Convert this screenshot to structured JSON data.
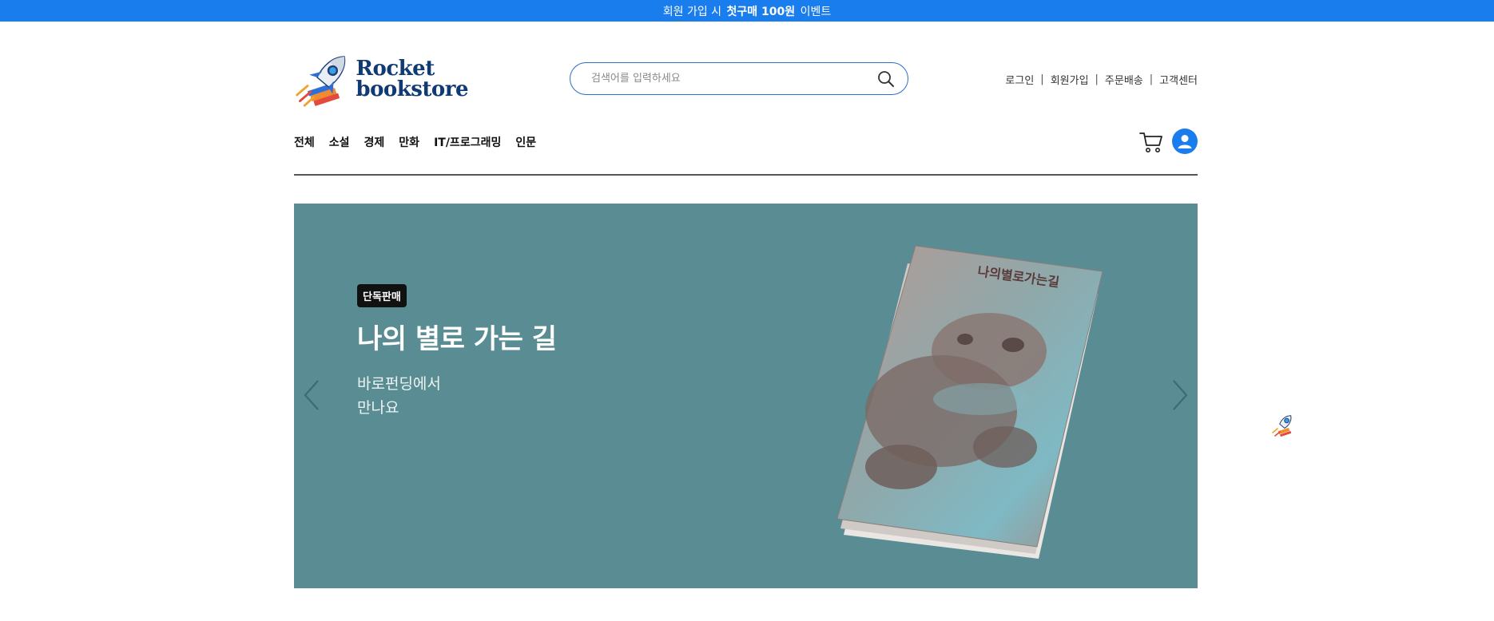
{
  "banner": {
    "pre": "회원 가입 시",
    "highlight": "첫구매 100원",
    "post": "이벤트"
  },
  "logo": {
    "line1": "Rocket",
    "line2": "bookstore",
    "icon": "rocket-icon"
  },
  "search": {
    "placeholder": "검색어를 입력하세요",
    "value": "",
    "icon": "search-icon"
  },
  "util_links": [
    "로그인",
    "회원가입",
    "주문배송",
    "고객센터"
  ],
  "nav": [
    "전체",
    "소설",
    "경제",
    "만화",
    "IT/프로그래밍",
    "인문"
  ],
  "header_icons": {
    "cart": "cart-icon",
    "user": "user-icon"
  },
  "hero": {
    "badge": "단독판매",
    "title": "나의 별로 가는 길",
    "subtitle_line1": "바로펀딩에서",
    "subtitle_line2": "만나요",
    "book_title": "나의별로가는길",
    "background": "#5a8c93",
    "prev_icon": "chevron-left-icon",
    "next_icon": "chevron-right-icon"
  },
  "colors": {
    "brand": "#1a7ded",
    "logo_text": "#0f3a73"
  }
}
